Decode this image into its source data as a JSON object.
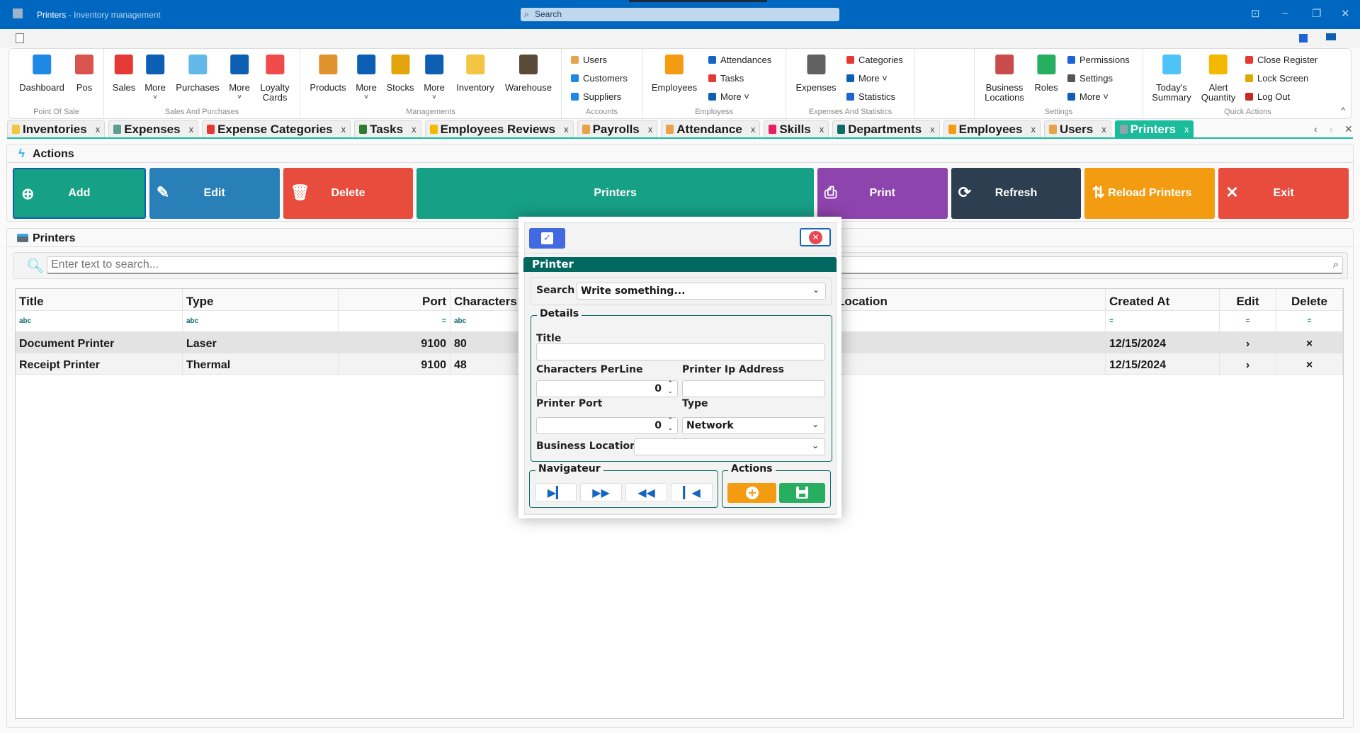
{
  "window": {
    "title": "Printers",
    "subtitle": " - Inventory management",
    "search_placeholder": "Search",
    "minimize": "–",
    "restore": "❐",
    "close": "✕",
    "pin": "⊡"
  },
  "colors": {
    "titlebar": "#0067c0",
    "accent": "#1abc9c",
    "dialog_header": "#006861"
  },
  "ribbon": {
    "groups": [
      "Point Of Sale",
      "Sales And Purchases",
      "Managements",
      "Accounts",
      "Employess",
      "Expenses And Statistics",
      "",
      "Settings",
      "Quick Actions"
    ],
    "big": [
      {
        "label": "Dashboard",
        "icon": "dashboard-icon",
        "color": "#1e88e5"
      },
      {
        "label": "Pos",
        "icon": "cash-register-icon",
        "color": "#d9534f"
      },
      {
        "label": "Sales",
        "icon": "sale-badge-icon",
        "color": "#e53935"
      },
      {
        "label": "More",
        "icon": "more-icon",
        "color": "#0d5fb3",
        "chevron": "˅"
      },
      {
        "label": "Purchases",
        "icon": "receipt-icon",
        "color": "#62b8e6"
      },
      {
        "label": "More",
        "icon": "more-icon",
        "color": "#0d5fb3",
        "chevron": "˅"
      },
      {
        "label": "Loyalty",
        "label2": "Cards",
        "icon": "percent-icon",
        "color": "#ef4b4b"
      },
      {
        "label": "Products",
        "icon": "box-icon",
        "color": "#e0922f"
      },
      {
        "label": "More",
        "icon": "more-icon",
        "color": "#0d5fb3",
        "chevron": "˅"
      },
      {
        "label": "Stocks",
        "icon": "cart-icon",
        "color": "#e2a30b"
      },
      {
        "label": "More",
        "icon": "more-icon",
        "color": "#0d5fb3",
        "chevron": "˅"
      },
      {
        "label": "Inventory",
        "icon": "inventory-icon",
        "color": "#f4c542"
      },
      {
        "label": "Warehouse",
        "icon": "warehouse-icon",
        "color": "#5a4a3a"
      },
      {
        "label": "Employees",
        "icon": "worker-icon",
        "color": "#f39c12"
      },
      {
        "label": "Expenses",
        "icon": "money-bag-icon",
        "color": "#616161"
      },
      {
        "label": "Business",
        "label2": "Locations",
        "icon": "store-icon",
        "color": "#c94b4b"
      },
      {
        "label": "Roles",
        "icon": "shield-check-icon",
        "color": "#27ae60"
      },
      {
        "label": "Today's",
        "label2": "Summary",
        "icon": "summary-icon",
        "color": "#4fc3f7"
      },
      {
        "label": "Alert",
        "label2": "Quantity",
        "icon": "bell-icon",
        "color": "#f5b800"
      }
    ],
    "small": [
      {
        "label": "Users",
        "icon": "users-icon",
        "color": "#e8a24a"
      },
      {
        "label": "Customers",
        "icon": "customers-icon",
        "color": "#1e88e5"
      },
      {
        "label": "Suppliers",
        "icon": "supplier-icon",
        "color": "#1e88e5"
      },
      {
        "label": "Attendances",
        "icon": "attendance-icon",
        "color": "#1565c0"
      },
      {
        "label": "Tasks",
        "icon": "tasks-icon",
        "color": "#e53935"
      },
      {
        "label": "More ˅",
        "icon": "more-icon",
        "color": "#0d5fb3"
      },
      {
        "label": "Categories",
        "icon": "tag-icon",
        "color": "#e53935"
      },
      {
        "label": "More ˅",
        "icon": "more-icon",
        "color": "#0d5fb3"
      },
      {
        "label": "Statistics",
        "icon": "chart-icon",
        "color": "#1e63d6"
      },
      {
        "label": "Permissions",
        "icon": "permissions-icon",
        "color": "#1e63d6"
      },
      {
        "label": "Settings",
        "icon": "gear-icon",
        "color": "#555"
      },
      {
        "label": "More ˅",
        "icon": "more-icon",
        "color": "#0d5fb3"
      },
      {
        "label": "Close Register",
        "icon": "close-register-icon",
        "color": "#e53935"
      },
      {
        "label": "Lock Screen",
        "icon": "lock-icon",
        "color": "#e0a800"
      },
      {
        "label": "Log Out",
        "icon": "logout-icon",
        "color": "#c62828"
      }
    ],
    "collapse": "^"
  },
  "tabs": [
    {
      "label": "Inventories",
      "color": "#f4c542"
    },
    {
      "label": "Expenses",
      "color": "#5a9e8f"
    },
    {
      "label": "Expense Categories",
      "color": "#e53935"
    },
    {
      "label": "Tasks",
      "color": "#2e7d32"
    },
    {
      "label": "Employees Reviews",
      "color": "#f5b800"
    },
    {
      "label": "Payrolls",
      "color": "#e8a24a"
    },
    {
      "label": "Attendance",
      "color": "#e8a24a"
    },
    {
      "label": "Skills",
      "color": "#e91e63"
    },
    {
      "label": "Departments",
      "color": "#0e6b67"
    },
    {
      "label": "Employees",
      "color": "#f39c12"
    },
    {
      "label": "Users",
      "color": "#e8a24a"
    },
    {
      "label": "Printers",
      "color": "#90a4ae",
      "active": true
    }
  ],
  "tab_close": "x",
  "tab_nav": {
    "prev": "‹",
    "next": "›",
    "close": "✕"
  },
  "actions": {
    "title": "Actions",
    "buttons": [
      {
        "label": "Add",
        "icon": "⊕",
        "color": "#16a085"
      },
      {
        "label": "Edit",
        "icon": "✎",
        "color": "#2980b9"
      },
      {
        "label": "Delete",
        "icon": "🗑",
        "color": "#e74c3c"
      },
      {
        "label": "Printers",
        "icon": "",
        "color": "#16a085"
      },
      {
        "label": "Print",
        "icon": "⎙",
        "color": "#8e44ad"
      },
      {
        "label": "Refresh",
        "icon": "⟳",
        "color": "#2c3e50"
      },
      {
        "label": "Reload Printers",
        "icon": "⇅",
        "color": "#f39c12"
      },
      {
        "label": "Exit",
        "icon": "✕",
        "color": "#e74c3c"
      }
    ]
  },
  "grid": {
    "title": "Printers",
    "search_placeholder": "Enter text to search...",
    "columns": [
      "Title",
      "Type",
      "Port",
      "Characters",
      "",
      "Location",
      "Created At",
      "Edit",
      "Delete"
    ],
    "filters": [
      "abc",
      "abc",
      "=",
      "abc",
      "",
      "",
      "=",
      "=",
      "="
    ],
    "rows": [
      [
        "Document Printer",
        "Laser",
        "9100",
        "80",
        "",
        "",
        "12/15/2024",
        "›",
        "×"
      ],
      [
        "Receipt Printer",
        "Thermal",
        "9100",
        "48",
        "",
        "",
        "12/15/2024",
        "›",
        "×"
      ]
    ]
  },
  "dialog": {
    "header": "Printer",
    "search_label": "Search",
    "search_placeholder": "Write something...",
    "details_legend": "Details",
    "title_label": "Title",
    "title_value": "",
    "cpl_label": "Characters PerLine",
    "cpl_value": "0",
    "ip_label": "Printer Ip Address",
    "ip_value": "",
    "port_label": "Printer Port",
    "port_value": "0",
    "type_label": "Type",
    "type_value": "Network",
    "location_label": "Business Location",
    "location_value": "",
    "nav_legend": "Navigateur",
    "actions_legend": "Actions"
  }
}
